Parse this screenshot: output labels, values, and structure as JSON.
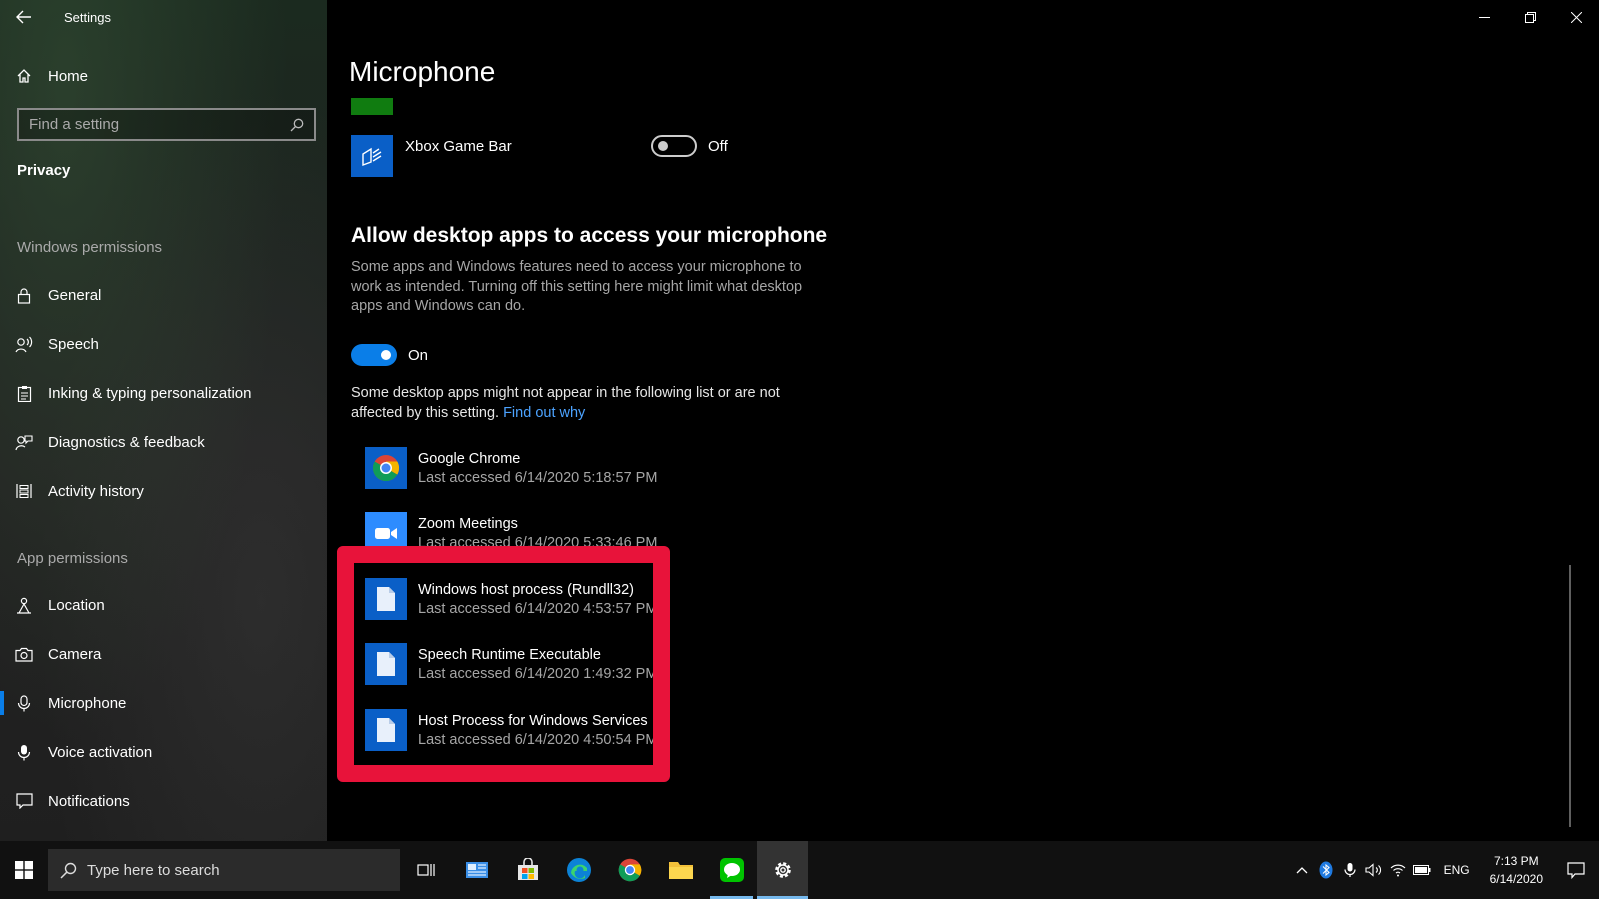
{
  "window": {
    "app_title": "Settings"
  },
  "sidebar": {
    "home_label": "Home",
    "search_placeholder": "Find a setting",
    "section_title": "Privacy",
    "windows_permissions_title": "Windows permissions",
    "windows_permissions": [
      {
        "label": "General",
        "icon": "lock-icon"
      },
      {
        "label": "Speech",
        "icon": "speech-icon"
      },
      {
        "label": "Inking & typing personalization",
        "icon": "clipboard-icon"
      },
      {
        "label": "Diagnostics & feedback",
        "icon": "feedback-icon"
      },
      {
        "label": "Activity history",
        "icon": "activity-history-icon"
      }
    ],
    "app_permissions_title": "App permissions",
    "app_permissions": [
      {
        "label": "Location",
        "icon": "location-icon"
      },
      {
        "label": "Camera",
        "icon": "camera-icon"
      },
      {
        "label": "Microphone",
        "icon": "microphone-icon",
        "active": true
      },
      {
        "label": "Voice activation",
        "icon": "voice-activation-icon"
      },
      {
        "label": "Notifications",
        "icon": "notifications-icon"
      }
    ]
  },
  "main": {
    "page_title": "Microphone",
    "xbox": {
      "name": "Xbox Game Bar",
      "toggle_state": "Off"
    },
    "desktop_section": {
      "heading": "Allow desktop apps to access your microphone",
      "description": "Some apps and Windows features need to access your microphone to work as intended. Turning off this setting here might limit what desktop apps and Windows can do.",
      "toggle_state": "On",
      "note": "Some desktop apps might not appear in the following list or are not affected by this setting.",
      "link": "Find out why"
    },
    "apps": [
      {
        "name": "Google Chrome",
        "last_accessed": "Last accessed 6/14/2020 5:18:57 PM",
        "icon": "chrome-icon"
      },
      {
        "name": "Zoom Meetings",
        "last_accessed": "Last accessed 6/14/2020 5:33:46 PM",
        "icon": "zoom-icon"
      },
      {
        "name": "Windows host process (Rundll32)",
        "last_accessed": "Last accessed 6/14/2020 4:53:57 PM",
        "icon": "file-icon"
      },
      {
        "name": "Speech Runtime Executable",
        "last_accessed": "Last accessed 6/14/2020 1:49:32 PM",
        "icon": "file-icon"
      },
      {
        "name": "Host Process for Windows Services",
        "last_accessed": "Last accessed 6/14/2020 4:50:54 PM",
        "icon": "file-icon"
      }
    ],
    "highlight_color": "#e8133a"
  },
  "taskbar": {
    "search_placeholder": "Type here to search",
    "language": "ENG",
    "time": "7:13 PM",
    "date": "6/14/2020"
  },
  "colors": {
    "accent": "#0a7ee8",
    "link": "#4ca3ff"
  }
}
